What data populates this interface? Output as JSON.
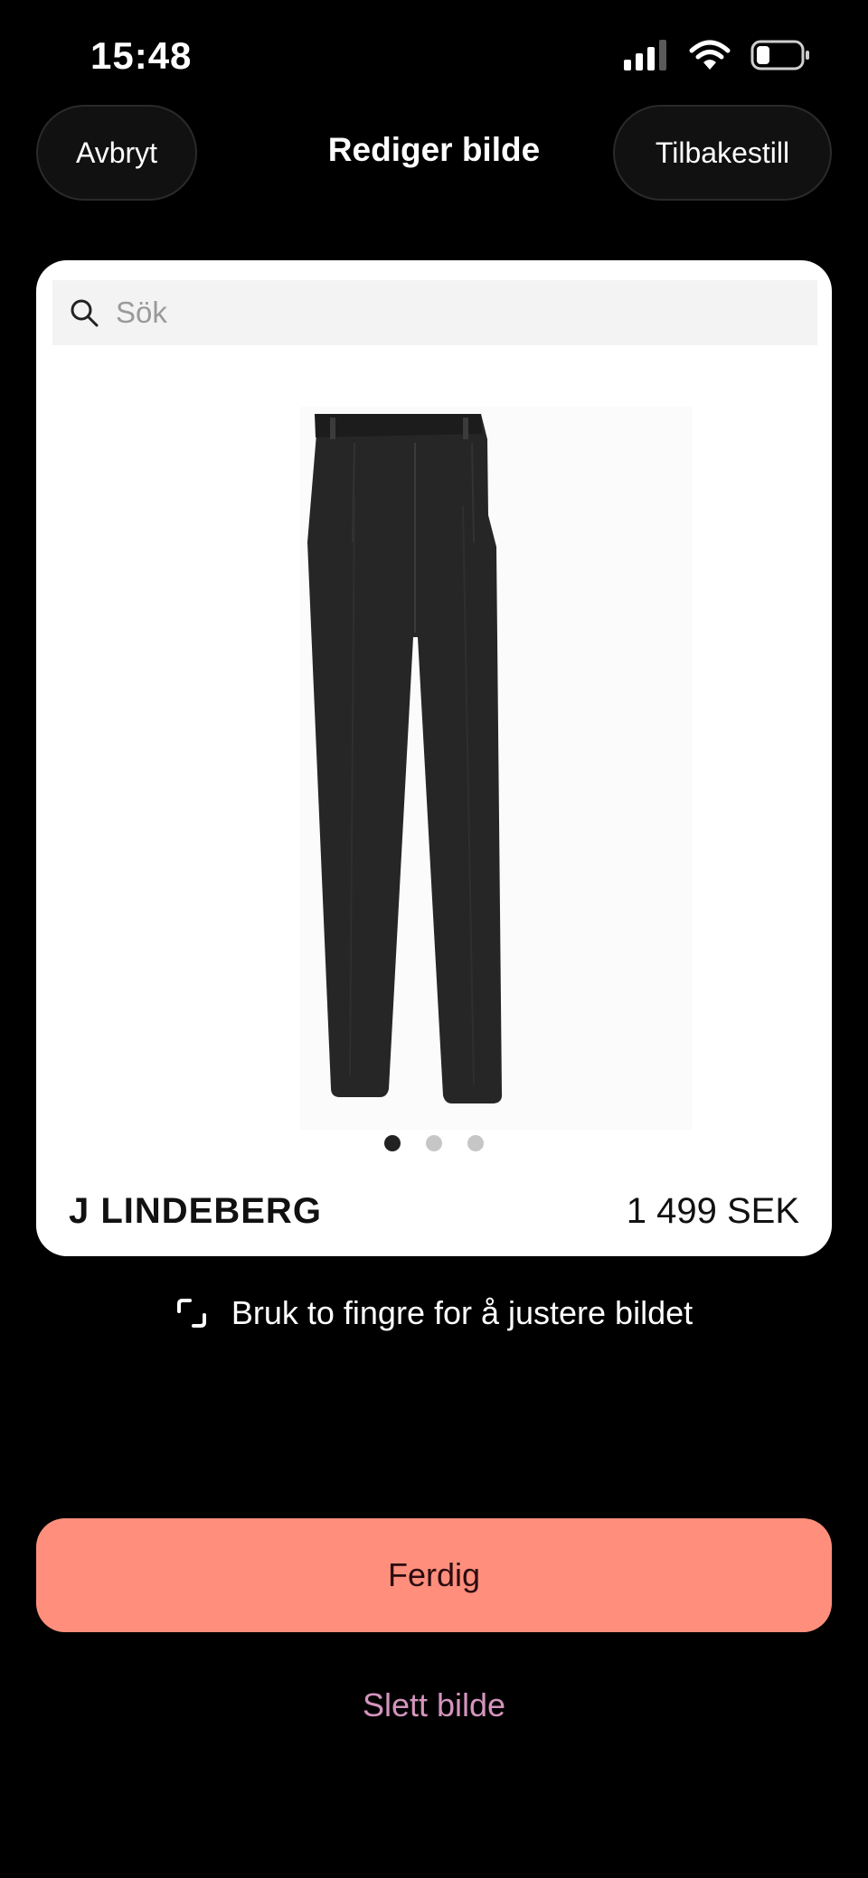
{
  "status_bar": {
    "time": "15:48",
    "icons": [
      "cellular-signal-icon",
      "wifi-icon",
      "battery-icon"
    ]
  },
  "nav": {
    "cancel_label": "Avbryt",
    "title": "Rediger bilde",
    "reset_label": "Tilbakestill"
  },
  "card": {
    "search_placeholder": "Sök",
    "image_pages_total": 3,
    "image_page_current": 1,
    "brand": "J LINDEBERG",
    "price": "1 499 SEK"
  },
  "hint": {
    "icon": "crop-icon",
    "text": "Bruk to fingre for å justere bildet"
  },
  "actions": {
    "done_label": "Ferdig",
    "delete_label": "Slett bilde"
  },
  "colors": {
    "accent": "#FF8F7C",
    "delete_link": "#D494BD"
  }
}
